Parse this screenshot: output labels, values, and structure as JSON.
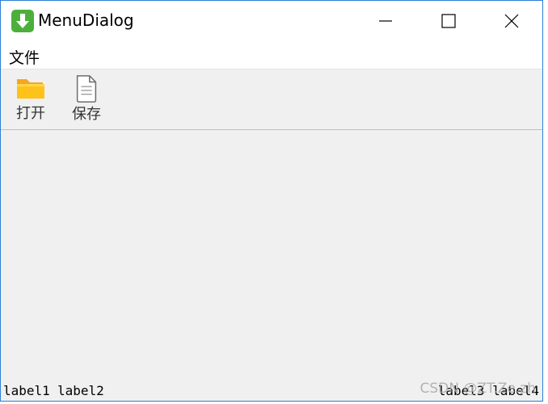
{
  "window": {
    "title": "MenuDialog",
    "icon": "download-arrow-icon",
    "controls": {
      "minimize": "minimize-icon",
      "maximize": "maximize-icon",
      "close": "close-icon"
    },
    "colors": {
      "border": "#2f7fd6",
      "icon_green": "#4caf3c",
      "background": "#f0f0f0"
    }
  },
  "menubar": {
    "items": [
      "文件"
    ]
  },
  "toolbar": {
    "open": {
      "label": "打开",
      "icon": "folder-icon"
    },
    "save": {
      "label": "保存",
      "icon": "document-icon"
    }
  },
  "statusbar": {
    "label1": "label1",
    "label2": "label2",
    "label3": "label3 label4"
  },
  "watermark": "CSDN @ZT.Ze.zh"
}
